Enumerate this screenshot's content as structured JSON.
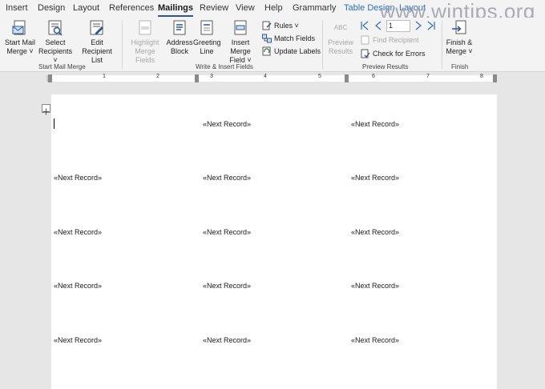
{
  "tabs": {
    "insert": "Insert",
    "design": "Design",
    "layout": "Layout",
    "references": "References",
    "mailings": "Mailings",
    "review": "Review",
    "view": "View",
    "help": "Help",
    "grammarly": "Grammarly",
    "table_design": "Table Design",
    "layout2": "Layout"
  },
  "watermark": "www.wintips.org",
  "ribbon": {
    "start_mail_merge": {
      "label": "Start Mail Merge",
      "start_mail_merge": [
        "Start Mail",
        "Merge ˅"
      ],
      "select_recipients": [
        "Select",
        "Recipients ˅"
      ],
      "edit_recipient_list": [
        "Edit",
        "Recipient List"
      ]
    },
    "write_insert_fields": {
      "label": "Write & Insert Fields",
      "highlight_merge_fields": [
        "Highlight",
        "Merge Fields"
      ],
      "address_block": [
        "Address",
        "Block"
      ],
      "greeting_line": [
        "Greeting",
        "Line"
      ],
      "insert_merge_field": [
        "Insert Merge",
        "Field ˅"
      ],
      "rules": "Rules ˅",
      "match_fields": "Match Fields",
      "update_labels": "Update Labels"
    },
    "preview_results": {
      "label": "Preview Results",
      "preview_results": [
        "Preview",
        "Results"
      ],
      "preview_icon_text": "ABC",
      "record_number": "1",
      "find_recipient": "Find Recipient",
      "check_for_errors": "Check for Errors"
    },
    "finish": {
      "label": "Finish",
      "finish_merge": [
        "Finish &",
        "Merge ˅"
      ]
    }
  },
  "ruler": {
    "numbers": [
      "1",
      "2",
      "3",
      "4",
      "5",
      "6",
      "7",
      "8"
    ]
  },
  "document": {
    "records": [
      [
        "",
        "«Next Record»",
        "«Next Record»"
      ],
      [
        "«Next Record»",
        "«Next Record»",
        "«Next Record»"
      ],
      [
        "«Next Record»",
        "«Next Record»",
        "«Next Record»"
      ],
      [
        "«Next Record»",
        "«Next Record»",
        "«Next Record»"
      ],
      [
        "«Next Record»",
        "«Next Record»",
        "«Next Record»"
      ]
    ]
  },
  "colors": {
    "accent": "#2b579a",
    "contextual_tab": "#2b6fc4",
    "disabled": "#a8a8a8",
    "ribbon_bg": "#f3f3f3",
    "canvas_bg": "#e6e6e6"
  }
}
